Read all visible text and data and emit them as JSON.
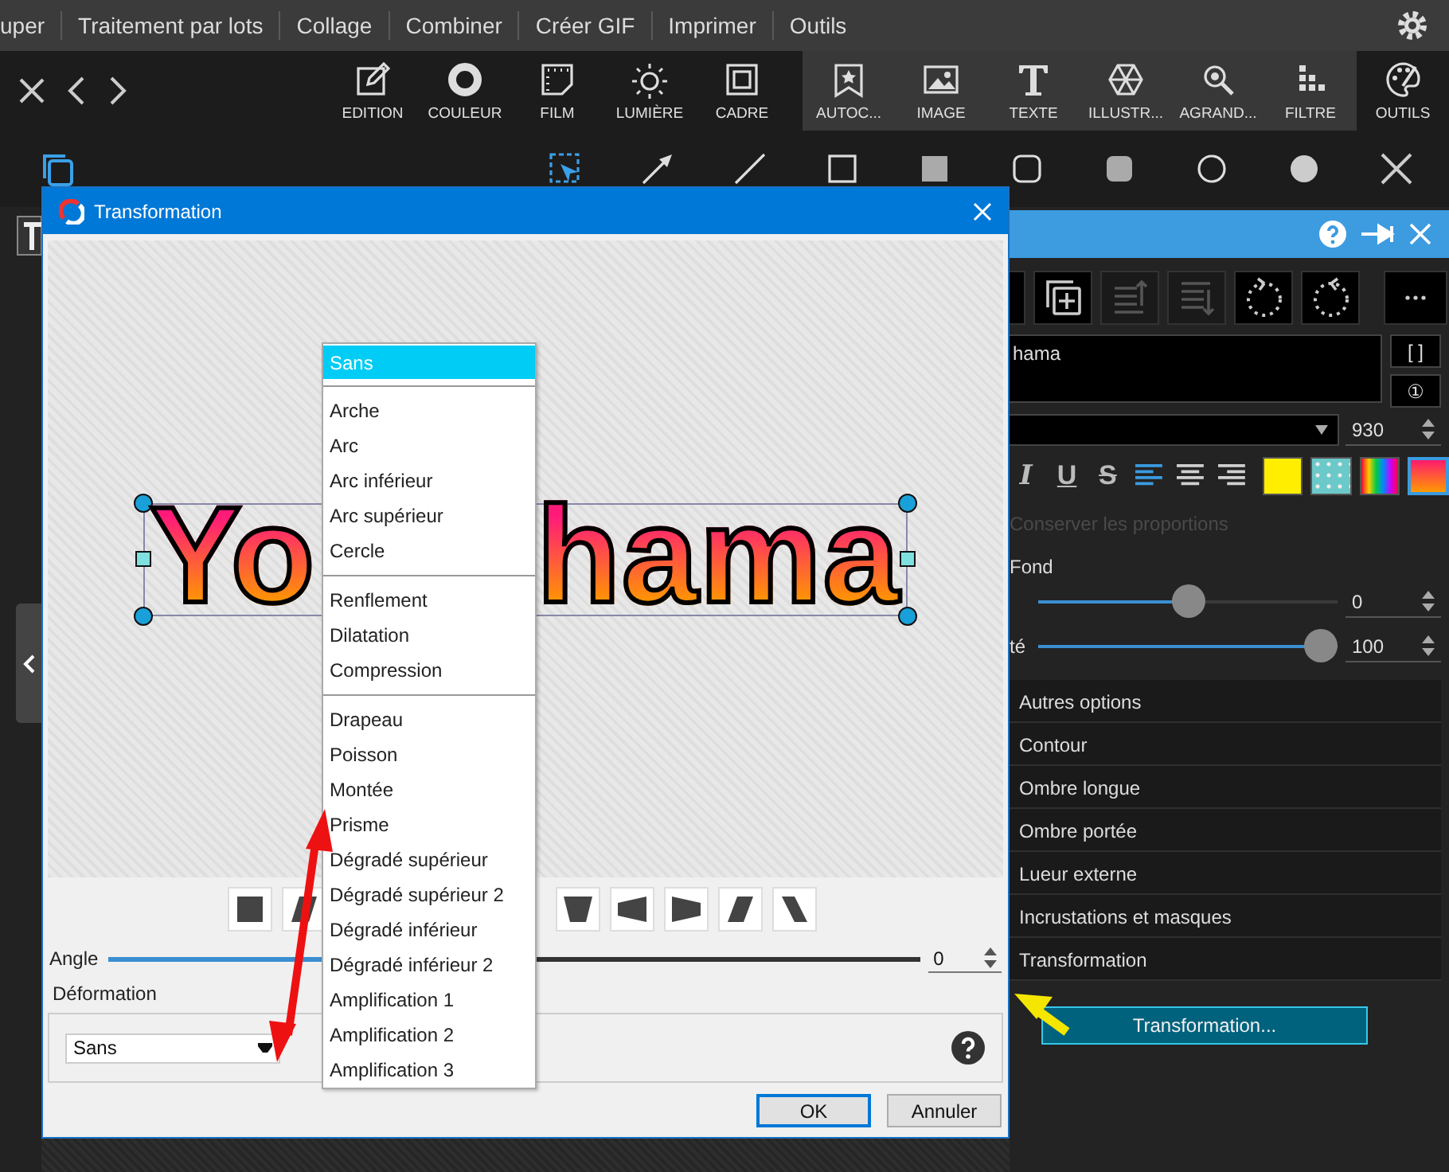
{
  "menu_bar": {
    "items": [
      "uper",
      "Traitement par lots",
      "Collage",
      "Combiner",
      "Créer GIF",
      "Imprimer",
      "Outils"
    ]
  },
  "toolbar": {
    "sections": [
      {
        "shaded": false,
        "items": [
          "EDITION",
          "COULEUR",
          "FILM",
          "LUMIÈRE",
          "CADRE"
        ]
      },
      {
        "shaded": true,
        "items": [
          "AUTOC...",
          "IMAGE",
          "TEXTE",
          "ILLUSTR...",
          "AGRAND...",
          "FILTRE"
        ]
      },
      {
        "shaded": false,
        "items": [
          "OUTILS"
        ]
      }
    ]
  },
  "side_panel": {
    "text_value": "hama",
    "bracket_button": "[ ]",
    "number_button": "①",
    "font_size": "930",
    "styles": [
      {
        "label": "I",
        "kind": "italic"
      },
      {
        "label": "U",
        "kind": "underline"
      },
      {
        "label": "S",
        "kind": "strike"
      }
    ],
    "alignments": [
      {
        "kind": "left",
        "selected": true
      },
      {
        "kind": "center",
        "selected": false
      },
      {
        "kind": "right",
        "selected": false
      }
    ],
    "fills": [
      {
        "kind": "solid",
        "selected": false
      },
      {
        "kind": "pattern",
        "selected": false
      },
      {
        "kind": "spectrum",
        "selected": false
      },
      {
        "kind": "gradient",
        "selected": true
      }
    ],
    "keep_ratio": {
      "label": "Conserver les proportions",
      "disabled": true
    },
    "fond_label": "Fond",
    "sliders": [
      {
        "level": 0.5,
        "value": "0"
      },
      {
        "label": "té",
        "level": 1,
        "value": "100"
      }
    ],
    "sections": [
      "Autres options",
      "Contour",
      "Ombre longue",
      "Ombre portée",
      "Lueur externe",
      "Incrustations et masques",
      "Transformation"
    ],
    "action_button": "Transformation..."
  },
  "dialog": {
    "title": "Transformation",
    "preview_text": [
      "Yo",
      "hama"
    ],
    "angle": {
      "label": "Angle",
      "level": 0.5,
      "value": "0"
    },
    "deformation": {
      "label": "Déformation",
      "value": "Sans"
    },
    "buttons": [
      {
        "label": "OK",
        "default": true
      },
      {
        "label": "Annuler",
        "default": false
      }
    ]
  },
  "dropdown_menu": {
    "items": [
      {
        "kind": "item",
        "label": "Sans",
        "selected": true
      },
      {
        "kind": "separator"
      },
      {
        "kind": "item",
        "label": "Arche",
        "selected": false
      },
      {
        "kind": "item",
        "label": "Arc",
        "selected": false
      },
      {
        "kind": "item",
        "label": "Arc inférieur",
        "selected": false
      },
      {
        "kind": "item",
        "label": "Arc supérieur",
        "selected": false
      },
      {
        "kind": "item",
        "label": "Cercle",
        "selected": false
      },
      {
        "kind": "separator"
      },
      {
        "kind": "item",
        "label": "Renflement",
        "selected": false
      },
      {
        "kind": "item",
        "label": "Dilatation",
        "selected": false
      },
      {
        "kind": "item",
        "label": "Compression",
        "selected": false
      },
      {
        "kind": "separator"
      },
      {
        "kind": "item",
        "label": "Drapeau",
        "selected": false
      },
      {
        "kind": "item",
        "label": "Poisson",
        "selected": false
      },
      {
        "kind": "item",
        "label": "Montée",
        "selected": false
      },
      {
        "kind": "item",
        "label": "Prisme",
        "selected": false
      },
      {
        "kind": "item",
        "label": "Dégradé supérieur",
        "selected": false
      },
      {
        "kind": "item",
        "label": "Dégradé supérieur 2",
        "selected": false
      },
      {
        "kind": "item",
        "label": "Dégradé inférieur",
        "selected": false
      },
      {
        "kind": "item",
        "label": "Dégradé inférieur 2",
        "selected": false
      },
      {
        "kind": "item",
        "label": "Amplification 1",
        "selected": false
      },
      {
        "kind": "item",
        "label": "Amplification 2",
        "selected": false
      },
      {
        "kind": "item",
        "label": "Amplification 3",
        "selected": false
      }
    ]
  }
}
